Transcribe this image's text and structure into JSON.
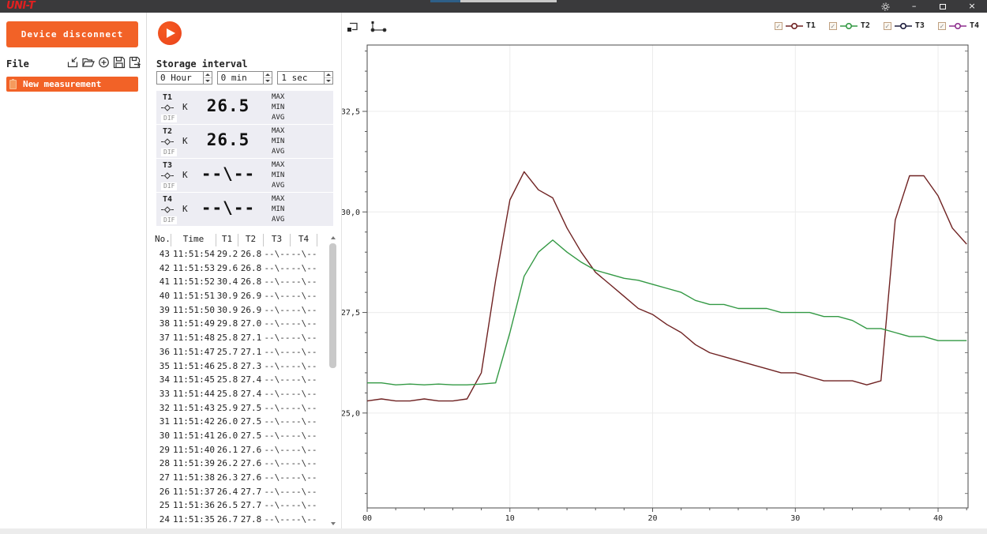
{
  "titlebar": {
    "logo": "UNI-T",
    "progress_done_color": "#2e5f88",
    "progress_rest_color": "#c9c9c9"
  },
  "icons": {
    "gear": "⚙",
    "minimize": "–",
    "close": "×",
    "check": "✓"
  },
  "left_panel": {
    "device_button": "Device disconnect",
    "file_label": "File",
    "new_measurement": "New measurement"
  },
  "storage": {
    "title": "Storage interval",
    "hour": "0 Hour",
    "min": "0 min",
    "sec": "1 sec"
  },
  "channels": [
    {
      "label": "T1",
      "tc": "K",
      "value": "26.5",
      "dif": "DIF",
      "stats": [
        "MAX",
        "MIN",
        "AVG"
      ]
    },
    {
      "label": "T2",
      "tc": "K",
      "value": "26.5",
      "dif": "DIF",
      "stats": [
        "MAX",
        "MIN",
        "AVG"
      ]
    },
    {
      "label": "T3",
      "tc": "K",
      "value": "--\\--",
      "dif": "DIF",
      "stats": [
        "MAX",
        "MIN",
        "AVG"
      ]
    },
    {
      "label": "T4",
      "tc": "K",
      "value": "--\\--",
      "dif": "DIF",
      "stats": [
        "MAX",
        "MIN",
        "AVG"
      ]
    }
  ],
  "table": {
    "headers": [
      "No.",
      "Time",
      "T1",
      "T2",
      "T3",
      "T4"
    ],
    "rows": [
      [
        "43",
        "11:51:54",
        "29.2",
        "26.8",
        "--\\--",
        "--\\--"
      ],
      [
        "42",
        "11:51:53",
        "29.6",
        "26.8",
        "--\\--",
        "--\\--"
      ],
      [
        "41",
        "11:51:52",
        "30.4",
        "26.8",
        "--\\--",
        "--\\--"
      ],
      [
        "40",
        "11:51:51",
        "30.9",
        "26.9",
        "--\\--",
        "--\\--"
      ],
      [
        "39",
        "11:51:50",
        "30.9",
        "26.9",
        "--\\--",
        "--\\--"
      ],
      [
        "38",
        "11:51:49",
        "29.8",
        "27.0",
        "--\\--",
        "--\\--"
      ],
      [
        "37",
        "11:51:48",
        "25.8",
        "27.1",
        "--\\--",
        "--\\--"
      ],
      [
        "36",
        "11:51:47",
        "25.7",
        "27.1",
        "--\\--",
        "--\\--"
      ],
      [
        "35",
        "11:51:46",
        "25.8",
        "27.3",
        "--\\--",
        "--\\--"
      ],
      [
        "34",
        "11:51:45",
        "25.8",
        "27.4",
        "--\\--",
        "--\\--"
      ],
      [
        "33",
        "11:51:44",
        "25.8",
        "27.4",
        "--\\--",
        "--\\--"
      ],
      [
        "32",
        "11:51:43",
        "25.9",
        "27.5",
        "--\\--",
        "--\\--"
      ],
      [
        "31",
        "11:51:42",
        "26.0",
        "27.5",
        "--\\--",
        "--\\--"
      ],
      [
        "30",
        "11:51:41",
        "26.0",
        "27.5",
        "--\\--",
        "--\\--"
      ],
      [
        "29",
        "11:51:40",
        "26.1",
        "27.6",
        "--\\--",
        "--\\--"
      ],
      [
        "28",
        "11:51:39",
        "26.2",
        "27.6",
        "--\\--",
        "--\\--"
      ],
      [
        "27",
        "11:51:38",
        "26.3",
        "27.6",
        "--\\--",
        "--\\--"
      ],
      [
        "26",
        "11:51:37",
        "26.4",
        "27.7",
        "--\\--",
        "--\\--"
      ],
      [
        "25",
        "11:51:36",
        "26.5",
        "27.7",
        "--\\--",
        "--\\--"
      ],
      [
        "24",
        "11:51:35",
        "26.7",
        "27.8",
        "--\\--",
        "--\\--"
      ]
    ]
  },
  "chart_data": {
    "type": "line",
    "x_ticks": [
      0,
      10,
      20,
      30,
      40
    ],
    "x_tick_labels": [
      "00",
      "10",
      "20",
      "30",
      "40"
    ],
    "x_minor_step": 2,
    "y_ticks": [
      25.0,
      27.5,
      30.0,
      32.5
    ],
    "y_tick_labels": [
      "25,0",
      "27,5",
      "30,0",
      "32,5"
    ],
    "y_minor_step": 0.5,
    "xlim": [
      0,
      42.1
    ],
    "ylim": [
      22.64,
      34.15
    ],
    "grid": true,
    "axis_color": "#4a4a4a",
    "grid_color": "#ececec",
    "series": [
      {
        "name": "T1",
        "color": "#6f2222",
        "values": [
          25.3,
          25.35,
          25.3,
          25.3,
          25.35,
          25.3,
          25.3,
          25.35,
          26.0,
          28.3,
          30.3,
          31.0,
          30.55,
          30.35,
          29.6,
          29.0,
          28.5,
          28.2,
          27.9,
          27.6,
          27.45,
          27.2,
          27.0,
          26.7,
          26.5,
          26.4,
          26.3,
          26.2,
          26.1,
          26.0,
          26.0,
          25.9,
          25.8,
          25.8,
          25.8,
          25.7,
          25.8,
          29.8,
          30.9,
          30.9,
          30.4,
          29.6,
          29.2
        ]
      },
      {
        "name": "T2",
        "color": "#339944",
        "values": [
          25.75,
          25.75,
          25.7,
          25.72,
          25.7,
          25.72,
          25.7,
          25.7,
          25.72,
          25.75,
          27.0,
          28.4,
          29.0,
          29.3,
          29.0,
          28.75,
          28.55,
          28.45,
          28.35,
          28.3,
          28.2,
          28.1,
          28.0,
          27.8,
          27.7,
          27.7,
          27.6,
          27.6,
          27.6,
          27.5,
          27.5,
          27.5,
          27.4,
          27.4,
          27.3,
          27.1,
          27.1,
          27.0,
          26.9,
          26.9,
          26.8,
          26.8,
          26.8
        ]
      },
      {
        "name": "T3",
        "color": "#1d1d3d",
        "values": []
      },
      {
        "name": "T4",
        "color": "#8e2f8e",
        "values": []
      }
    ],
    "legend": [
      {
        "label": "T1",
        "color": "#6f2222",
        "checked": true
      },
      {
        "label": "T2",
        "color": "#339944",
        "checked": true
      },
      {
        "label": "T3",
        "color": "#1d1d3d",
        "checked": true
      },
      {
        "label": "T4",
        "color": "#8e2f8e",
        "checked": true
      }
    ]
  }
}
